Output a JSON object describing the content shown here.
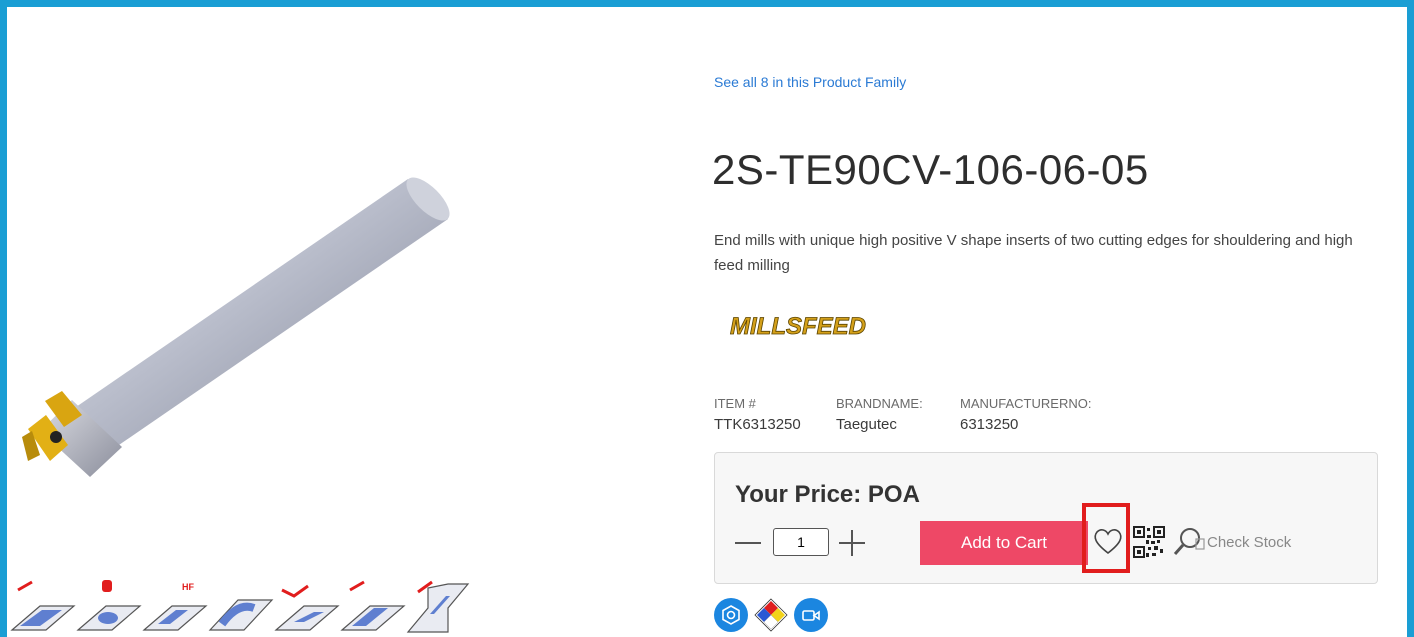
{
  "product": {
    "family_link": "See all 8 in this Product Family",
    "title": "2S-TE90CV-106-06-05",
    "description": "End mills with unique high positive V shape inserts of two cutting edges for shouldering and high feed milling",
    "brand_logo_text": "MILLSFEED"
  },
  "attributes": [
    {
      "label": "ITEM #",
      "value": "TTK6313250"
    },
    {
      "label": "BRANDNAME:",
      "value": "Taegutec"
    },
    {
      "label": "MANUFACTURERNO:",
      "value": "6313250"
    }
  ],
  "purchase": {
    "price_label": "Your Price: POA",
    "quantity": "1",
    "add_to_cart_label": "Add to Cart",
    "check_stock_label": "Check Stock"
  },
  "operations": [
    "shouldering",
    "helical-interpolation",
    "high-feed",
    "slotting-radius",
    "ramping",
    "plunging",
    "deep-shouldering"
  ],
  "colors": {
    "frame": "#1a9ed4",
    "link": "#2a7ad4",
    "add_to_cart": "#ee4866",
    "highlight": "#e11d1d",
    "badge": "#1b86e0"
  }
}
